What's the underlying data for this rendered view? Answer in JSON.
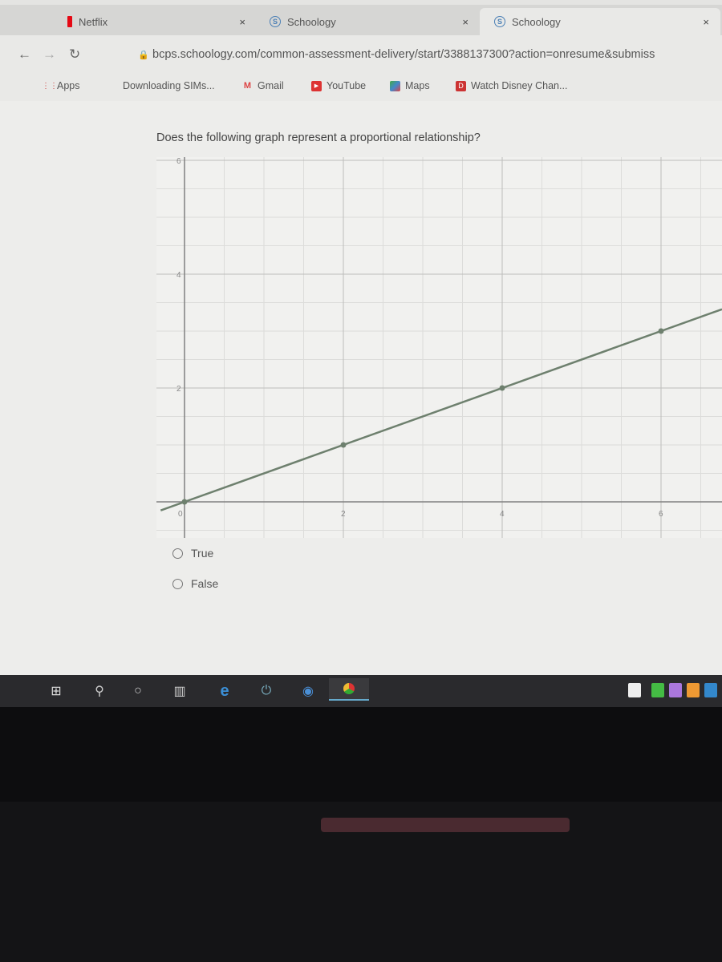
{
  "browser": {
    "tabs": [
      {
        "title": "Netflix",
        "icon": "netflix-icon",
        "color": "#e50914"
      },
      {
        "title": "Schoology",
        "icon": "schoology-icon",
        "color": "#4a7fb5"
      },
      {
        "title": "Schoology",
        "icon": "schoology-icon",
        "color": "#4a7fb5",
        "active": true
      }
    ],
    "close_glyph": "×",
    "url": "bcps.schoology.com/common-assessment-delivery/start/3388137300?action=onresume&submiss",
    "bookmarks": [
      {
        "label": "Apps",
        "icon": "apps-grid-icon"
      },
      {
        "label": "Downloading SIMs..."
      },
      {
        "label": "Gmail",
        "icon": "gmail-icon"
      },
      {
        "label": "YouTube",
        "icon": "youtube-icon"
      },
      {
        "label": "Maps",
        "icon": "maps-icon"
      },
      {
        "label": "Watch Disney Chan...",
        "icon": "disney-icon"
      }
    ]
  },
  "question": {
    "text": "Does the following graph represent a proportional relationship?",
    "options": [
      "True",
      "False"
    ]
  },
  "chart_data": {
    "type": "line",
    "x": [
      0,
      2,
      4,
      6
    ],
    "y": [
      0,
      1,
      2,
      3
    ],
    "xlim": [
      0,
      6.8
    ],
    "ylim": [
      0,
      6
    ],
    "x_ticks": [
      "0",
      "2",
      "4",
      "6"
    ],
    "y_ticks": [
      "2",
      "4",
      "6"
    ],
    "grid": true,
    "minor_grid_step": 0.5,
    "line_color": "#6e806e"
  },
  "taskbar": {
    "icons": [
      "windows-start-icon",
      "search-icon",
      "cortana-icon",
      "task-view-icon",
      "edge-icon",
      "power-app-icon",
      "chromium-icon",
      "chrome-icon"
    ]
  }
}
